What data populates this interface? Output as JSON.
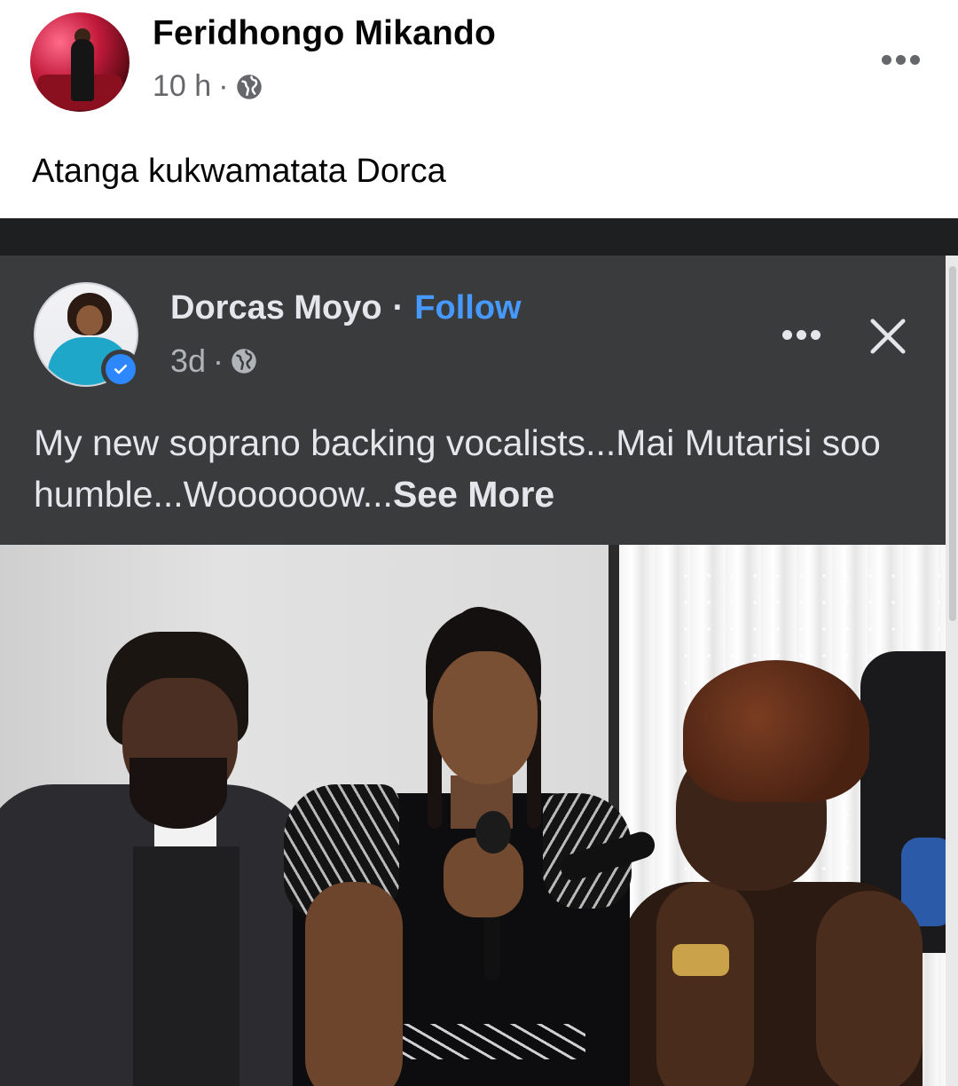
{
  "outer_post": {
    "author_name": "Feridhongo Mikando",
    "time": "10 h",
    "separator": "·",
    "caption": "Atanga kukwamatata Dorca",
    "privacy_icon": "globe-icon",
    "more_icon": "more-horizontal-icon"
  },
  "shared_post": {
    "author_name": "Dorcas Moyo",
    "name_separator": "·",
    "follow_label": "Follow",
    "time": "3d",
    "separator": "·",
    "verified_icon": "verified-badge-icon",
    "privacy_icon": "globe-icon",
    "body_text": "My new soprano backing vocalists...Mai Mutarisi soo humble...Woooooow...",
    "see_more_label": "See More",
    "close_icon": "close-icon"
  },
  "colors": {
    "dark_bg": "#3a3b3d",
    "link_blue": "#4599ff",
    "verified_blue": "#2d88ff",
    "meta_gray": "#65676b"
  }
}
